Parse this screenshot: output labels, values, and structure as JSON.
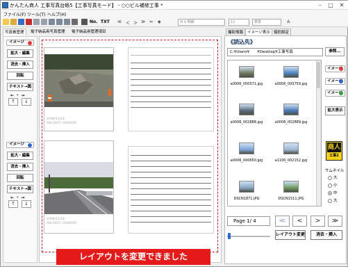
{
  "window": {
    "title": "かんたん商人 工事写真台帳5【工事写真モード】 - ○○ビル補修工事 *",
    "minimize_icon": "minimize-icon",
    "maximize_icon": "maximize-icon",
    "close_icon": "close-icon"
  },
  "menu": [
    "ファイル(F)",
    "ツール(T)",
    "ヘルプ(H)"
  ],
  "toolbar": {
    "font": "M S 明朝",
    "size": "12",
    "style": "標準",
    "no_label": "No.",
    "text_tool": "TXT"
  },
  "left_tabs": [
    "写真帳管理",
    "電子納品用写真管理",
    "電子納品用管理項目"
  ],
  "left_panel": {
    "group1": {
      "image_label": "イメージ",
      "badge": "1",
      "buttons": [
        "拡大・編集",
        "消去・挿入",
        "回転",
        "テキスト→図"
      ],
      "arrows": "← ・ →",
      "up": "↑",
      "down": "↓"
    },
    "group2": {
      "image_label": "イメージ",
      "badge": "2",
      "buttons": [
        "拡大・編集",
        "消去・挿入",
        "回転",
        "テキスト→図"
      ],
      "arrows": "← ・ →",
      "up": "↑",
      "down": "↓"
    }
  },
  "page": {
    "photo1_meta": [
      "2008/11/16",
      "ABCDEFG 0000000"
    ],
    "photo2_meta": [
      "2008/11/16",
      "ABCDEFG 0000000"
    ]
  },
  "banner": "レイアウトを変更できました",
  "right_tabs": [
    "撮影情報",
    "イメージ表示",
    "個別設定"
  ],
  "right_panel": {
    "header": "《読込先》",
    "path": "C:¥Users¥　　¥Desktop¥工事写真",
    "browse": "参照...",
    "thumbnails": [
      {
        "name": "a0006_000571.jpg",
        "color": "#6f7a62"
      },
      {
        "name": "a0006_000759.jpg",
        "color": "#4f84c4"
      },
      {
        "name": "a0006_002888.jpg",
        "color": "#5a6a78"
      },
      {
        "name": "a0006_002889.jpg",
        "color": "#4a7ab9"
      },
      {
        "name": "a0006_000650.jpg",
        "color": "#7fa7d9"
      },
      {
        "name": "a1100_002152.jpg",
        "color": "#9fb9d6"
      },
      {
        "name": "DSCN1871.JPG",
        "color": "#8aa6c4"
      },
      {
        "name": "DSCN1511.JPG",
        "color": "#6f9a5f"
      }
    ],
    "image_buttons": [
      {
        "label": "イメージ",
        "badge": "1",
        "color": "#e23a3a"
      },
      {
        "label": "イメージ",
        "badge": "2",
        "color": "#2f63c9"
      },
      {
        "label": "イメージ",
        "badge": "3",
        "color": "#34a43a"
      }
    ],
    "zoom_button": "拡大表示",
    "logo_text": "商人",
    "logo_sub": "工事2",
    "thumb_size_label": "サムネイル",
    "sizes": [
      {
        "label": "大",
        "on": false
      },
      {
        "label": "小",
        "on": false
      },
      {
        "label": "中",
        "on": true
      },
      {
        "label": "大",
        "on": false
      }
    ],
    "page_label": "Page 1/ 4",
    "nav": [
      "≪",
      "<",
      ">",
      "≫"
    ],
    "layout_button": "レイアウト変更",
    "erase_button": "消去・挿入"
  }
}
